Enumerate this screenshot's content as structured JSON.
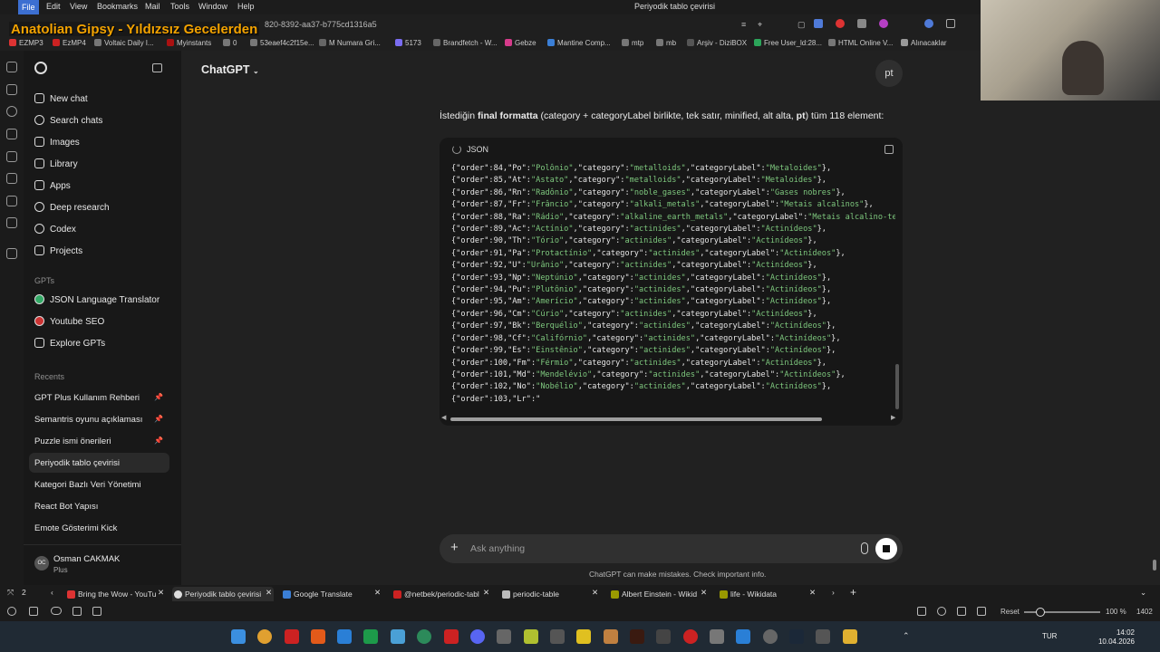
{
  "menubar": {
    "items": [
      "File",
      "Edit",
      "View",
      "Bookmarks",
      "Mail",
      "Tools",
      "Window",
      "Help"
    ],
    "window_title": "Periyodik tablo çevirisi"
  },
  "overlay_title": "Anatolian Gipsy - Yıldızsız Gecelerden",
  "address_bar": {
    "url_fragment": "820-8392-aa37-b775cd1316a5"
  },
  "bookmarks": [
    "EZMP3",
    "EzMP4",
    "Voltaic Daily I...",
    "Myinstants",
    "0",
    "53eaef4c2f15e...",
    "M Numara Gri...",
    "5173",
    "Brandfetch - W...",
    "Gebze",
    "Mantine Comp...",
    "mtp",
    "mb",
    "Arşiv - DiziBOX",
    "Free User_ld:28...",
    "HTML Online V...",
    "Alınacaklar"
  ],
  "sidebar": {
    "nav": [
      "New chat",
      "Search chats",
      "Images",
      "Library",
      "Apps",
      "Deep research",
      "Codex",
      "Projects"
    ],
    "gpts_label": "GPTs",
    "gpts": [
      "JSON Language Translator",
      "Youtube SEO",
      "Explore GPTs"
    ],
    "recents_label": "Recents",
    "recents": [
      "GPT Plus Kullanım Rehberi",
      "Semantris oyunu açıklaması",
      "Puzzle ismi önerileri",
      "Periyodik tablo çevirisi",
      "Kategori Bazlı Veri Yönetimi",
      "React Bot Yapısı",
      "Emote Gösterimi Kick"
    ],
    "user": {
      "name": "Osman CAKMAK",
      "plan": "Plus",
      "initials": "OC"
    }
  },
  "main": {
    "title": "ChatGPT",
    "avatar_text": "pt",
    "intro_parts": [
      "İstediğin ",
      "final formatta",
      " (category + categoryLabel birlikte, tek satır, minified, alt alta, ",
      "pt",
      ") tüm 118 element:"
    ],
    "code_lang": "JSON",
    "code_lines": [
      {
        "order": "84",
        "sym": "Po",
        "name": "Polônio",
        "category": "metalloids",
        "label": "Metaloides"
      },
      {
        "order": "85",
        "sym": "At",
        "name": "Astato",
        "category": "metalloids",
        "label": "Metaloides"
      },
      {
        "order": "86",
        "sym": "Rn",
        "name": "Radônio",
        "category": "noble_gases",
        "label": "Gases nobres"
      },
      {
        "order": "87",
        "sym": "Fr",
        "name": "Frâncio",
        "category": "alkali_metals",
        "label": "Metais alcalinos"
      },
      {
        "order": "88",
        "sym": "Ra",
        "name": "Rádio",
        "category": "alkaline_earth_metals",
        "label": "Metais alcalino-te"
      },
      {
        "order": "89",
        "sym": "Ac",
        "name": "Actínio",
        "category": "actinides",
        "label": "Actinídeos"
      },
      {
        "order": "90",
        "sym": "Th",
        "name": "Tório",
        "category": "actinides",
        "label": "Actinídeos"
      },
      {
        "order": "91",
        "sym": "Pa",
        "name": "Protactínio",
        "category": "actinides",
        "label": "Actinídeos"
      },
      {
        "order": "92",
        "sym": "U",
        "name": "Urânio",
        "category": "actinides",
        "label": "Actinídeos"
      },
      {
        "order": "93",
        "sym": "Np",
        "name": "Neptúnio",
        "category": "actinides",
        "label": "Actinídeos"
      },
      {
        "order": "94",
        "sym": "Pu",
        "name": "Plutônio",
        "category": "actinides",
        "label": "Actinídeos"
      },
      {
        "order": "95",
        "sym": "Am",
        "name": "Amerício",
        "category": "actinides",
        "label": "Actinídeos"
      },
      {
        "order": "96",
        "sym": "Cm",
        "name": "Cúrio",
        "category": "actinides",
        "label": "Actinídeos"
      },
      {
        "order": "97",
        "sym": "Bk",
        "name": "Berquélio",
        "category": "actinides",
        "label": "Actinídeos"
      },
      {
        "order": "98",
        "sym": "Cf",
        "name": "Califórnio",
        "category": "actinides",
        "label": "Actinídeos"
      },
      {
        "order": "99",
        "sym": "Es",
        "name": "Einstênio",
        "category": "actinides",
        "label": "Actinídeos"
      },
      {
        "order": "100",
        "sym": "Fm",
        "name": "Férmio",
        "category": "actinides",
        "label": "Actinídeos"
      },
      {
        "order": "101",
        "sym": "Md",
        "name": "Mendelévio",
        "category": "actinides",
        "label": "Actinídeos"
      },
      {
        "order": "102",
        "sym": "No",
        "name": "Nobélio",
        "category": "actinides",
        "label": "Actinídeos"
      }
    ],
    "code_partial_line": "{\"order\":103,\"Lr\":\"",
    "composer_placeholder": "Ask anything",
    "disclaimer": "ChatGPT can make mistakes. Check important info."
  },
  "tabs": {
    "workspace_count": "2",
    "items": [
      "Bring the Wow - YouTu",
      "Periyodik tablo çevirisi",
      "Google Translate",
      "@netbek/periodic-tabl",
      "periodic-table",
      "Albert Einstein - Wikid",
      "life - Wikidata"
    ]
  },
  "statusbar": {
    "reset": "Reset",
    "zoom": "100 %",
    "code": "1402"
  },
  "taskbar": {
    "lang": "TUR",
    "time": "14:02",
    "date": "10.04.2026"
  },
  "colors": {
    "code_string": "#7ec87e",
    "accent": "#3c6fd1",
    "overlay_title": "#f4a300"
  }
}
